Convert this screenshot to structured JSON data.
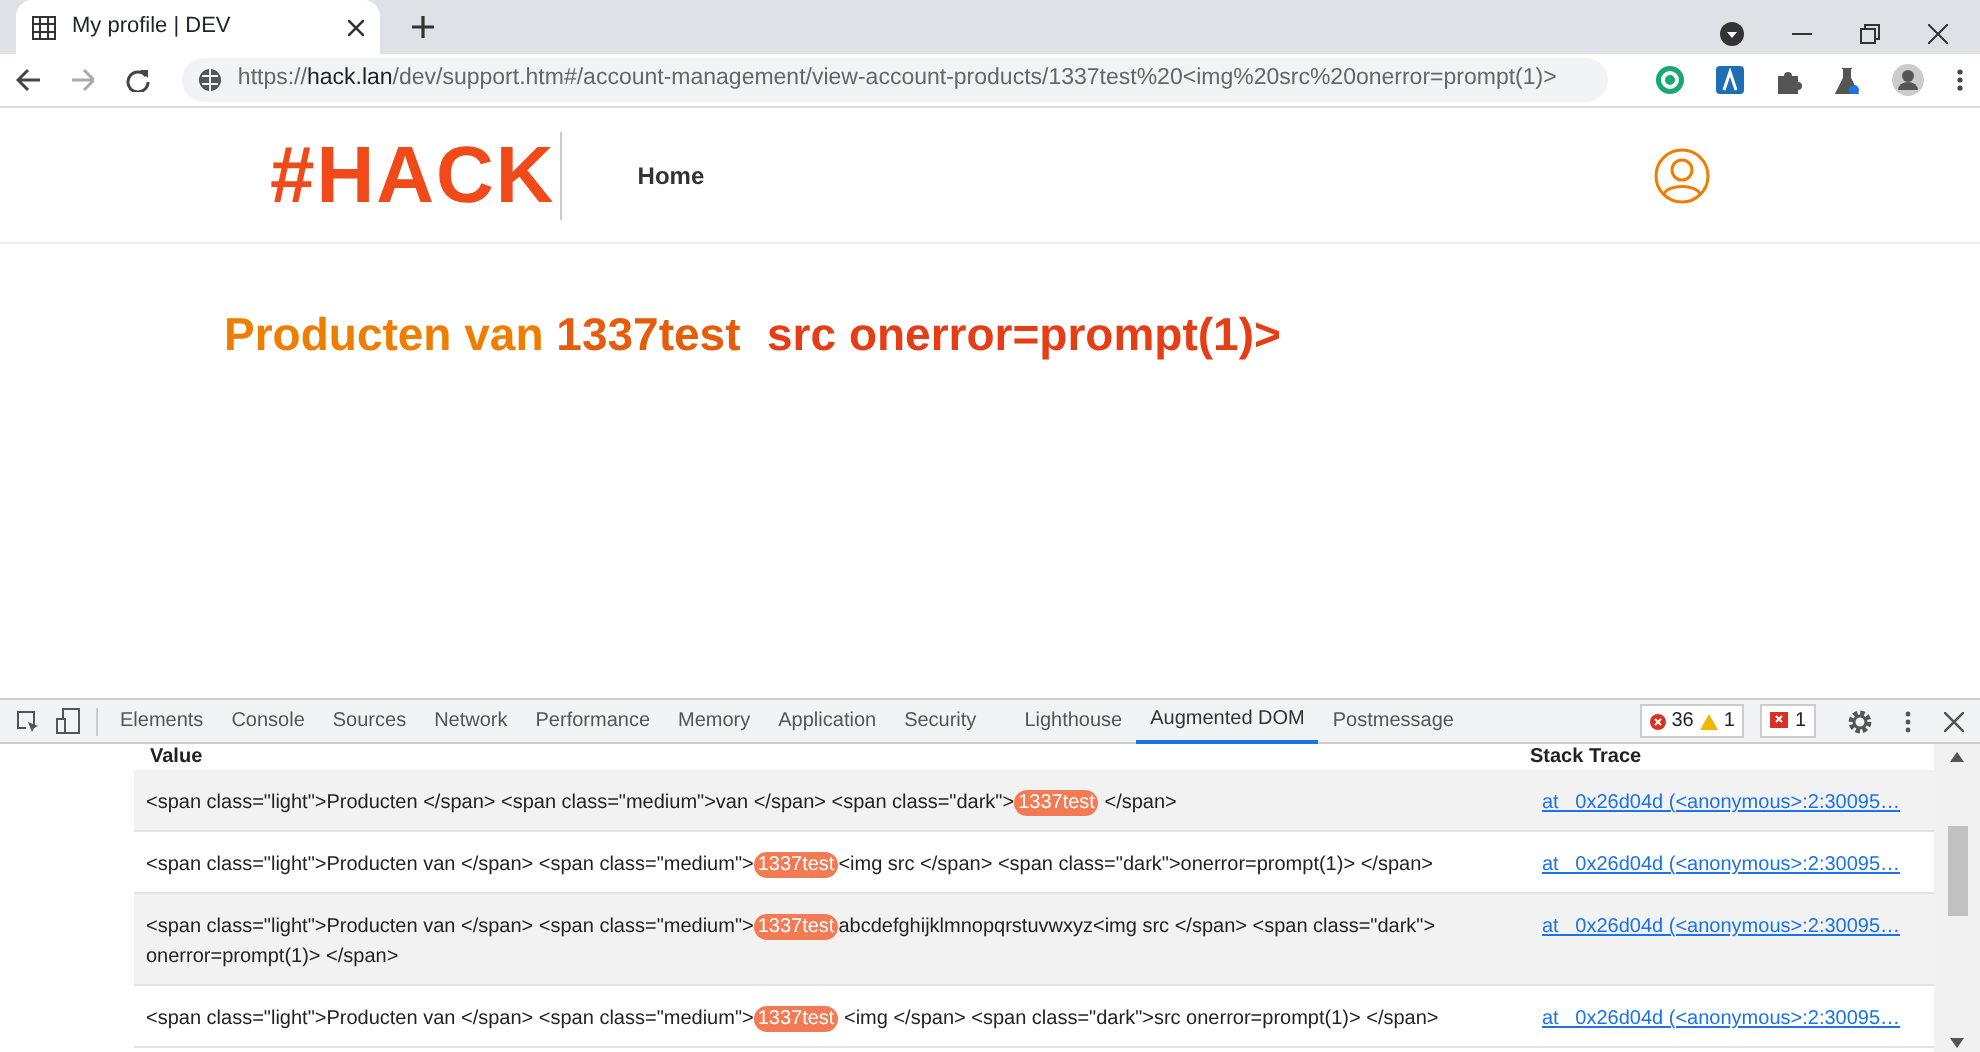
{
  "browser": {
    "tab_title": "My profile | DEV",
    "url_scheme": "https://",
    "url_host": "hack.lan",
    "url_path": "/dev/support.htm#/account-management/view-account-products/1337test%20<img%20src%20onerror=prompt(1)>"
  },
  "site": {
    "logo": "#HACK",
    "nav": [
      {
        "label": "Home"
      }
    ]
  },
  "heading": [
    {
      "kind": "light",
      "text": "Producten van"
    },
    {
      "kind": "medium",
      "text": "1337test"
    },
    {
      "kind": "dark",
      "text": "src onerror=prompt(1)>"
    }
  ],
  "devtools": {
    "tabs": [
      {
        "label": "Elements",
        "selected": false
      },
      {
        "label": "Console",
        "selected": false
      },
      {
        "label": "Sources",
        "selected": false
      },
      {
        "label": "Network",
        "selected": false
      },
      {
        "label": "Performance",
        "selected": false
      },
      {
        "label": "Memory",
        "selected": false
      },
      {
        "label": "Application",
        "selected": false
      },
      {
        "label": "Security",
        "selected": false
      },
      {
        "label": "Lighthouse",
        "selected": false
      },
      {
        "label": "Augmented DOM",
        "selected": true
      },
      {
        "label": "Postmessage",
        "selected": false
      }
    ],
    "errors": "36",
    "warnings": "1",
    "issues": "1",
    "table": {
      "columns": [
        "Value",
        "Stack Trace"
      ],
      "rows": [
        {
          "value": [
            {
              "text": "<span class=\"light\">Producten </span> <span class=\"medium\">van </span> <span class=\"dark\">",
              "highlight": false
            },
            {
              "text": "1337test",
              "highlight": true
            },
            {
              "text": " </span>",
              "highlight": false
            }
          ],
          "trace": "at _0x26d04d (<anonymous>:2:30095…"
        },
        {
          "value": [
            {
              "text": "<span class=\"light\">Producten van </span> <span class=\"medium\">",
              "highlight": false
            },
            {
              "text": "1337test",
              "highlight": true
            },
            {
              "text": "<img src </span> <span class=\"dark\">onerror=prompt(1)> </span>",
              "highlight": false
            }
          ],
          "trace": "at _0x26d04d (<anonymous>:2:30095…"
        },
        {
          "value": [
            {
              "text": "<span class=\"light\">Producten van </span> <span class=\"medium\">",
              "highlight": false
            },
            {
              "text": "1337test",
              "highlight": true
            },
            {
              "text": "abcdefghijklmnopqrstuvwxyz<img src </span> <span class=\"dark\"> onerror=prompt(1)> </span>",
              "highlight": false
            }
          ],
          "trace": "at _0x26d04d (<anonymous>:2:30095…"
        },
        {
          "value": [
            {
              "text": "<span class=\"light\">Producten van </span> <span class=\"medium\">",
              "highlight": false
            },
            {
              "text": "1337test",
              "highlight": true
            },
            {
              "text": " <img </span> <span class=\"dark\">src onerror=prompt(1)> </span>",
              "highlight": false
            }
          ],
          "trace": "at _0x26d04d (<anonymous>:2:30095…"
        }
      ]
    }
  }
}
